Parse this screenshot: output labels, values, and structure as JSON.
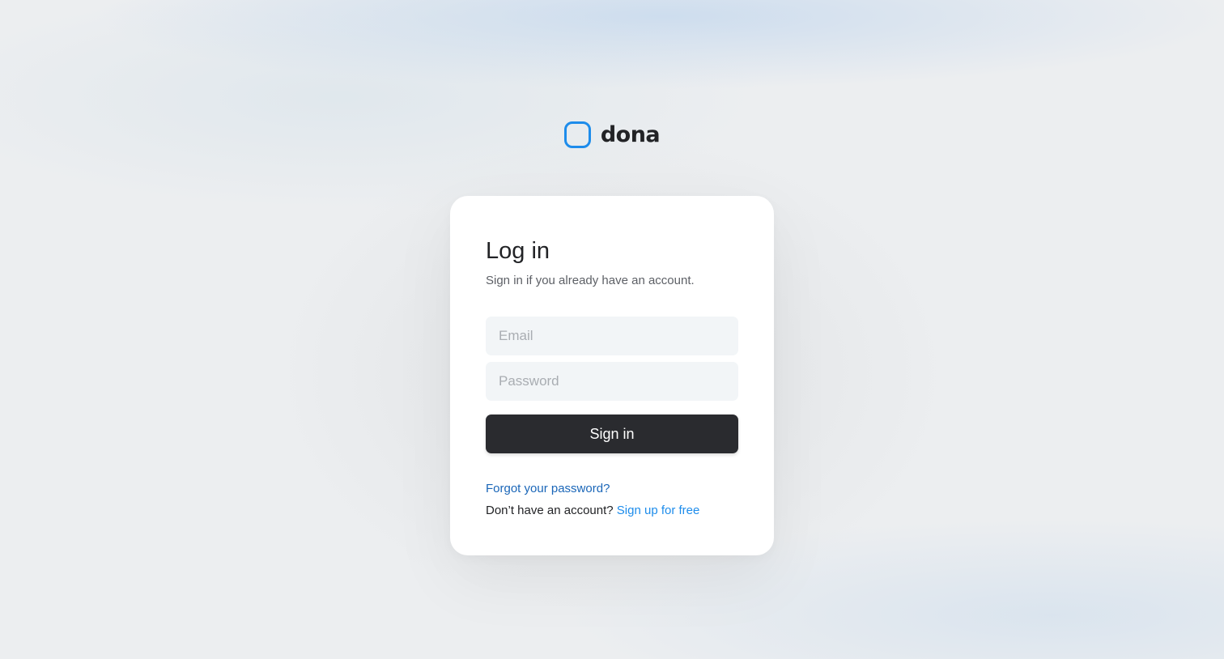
{
  "brand": {
    "name": "dona",
    "logo_icon": "rounded-square-icon",
    "accent_color": "#1d8ceb"
  },
  "login": {
    "title": "Log in",
    "subtitle": "Sign in if you already have an account.",
    "email": {
      "value": "",
      "placeholder": "Email"
    },
    "password": {
      "value": "",
      "placeholder": "Password"
    },
    "submit_label": "Sign in",
    "forgot_label": "Forgot your password?",
    "signup_prompt": "Don’t have an account?",
    "signup_label": "Sign up for free"
  },
  "colors": {
    "button_bg": "#2a2b2f",
    "link": "#1a66b8",
    "background": "#eceef0"
  }
}
